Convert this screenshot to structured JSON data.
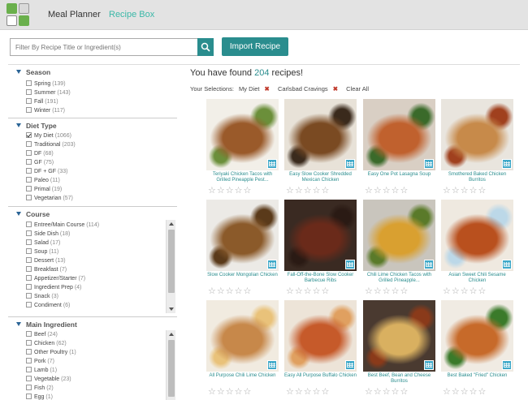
{
  "header": {
    "nav_planner": "Meal Planner",
    "nav_recipes": "Recipe Box"
  },
  "toolbar": {
    "search_placeholder": "Filter By Recipe Title or Ingredient(s)",
    "import_label": "Import Recipe"
  },
  "sidebar": {
    "season": {
      "title": "Season",
      "options": [
        {
          "label": "Spring",
          "count": "(139)",
          "checked": false
        },
        {
          "label": "Summer",
          "count": "(143)",
          "checked": false
        },
        {
          "label": "Fall",
          "count": "(191)",
          "checked": false
        },
        {
          "label": "Winter",
          "count": "(117)",
          "checked": false
        }
      ]
    },
    "diet": {
      "title": "Diet Type",
      "options": [
        {
          "label": "My Diet",
          "count": "(1066)",
          "checked": true
        },
        {
          "label": "Traditional",
          "count": "(203)",
          "checked": false
        },
        {
          "label": "DF",
          "count": "(68)",
          "checked": false
        },
        {
          "label": "GF",
          "count": "(75)",
          "checked": false
        },
        {
          "label": "DF + GF",
          "count": "(33)",
          "checked": false
        },
        {
          "label": "Paleo",
          "count": "(11)",
          "checked": false
        },
        {
          "label": "Primal",
          "count": "(19)",
          "checked": false
        },
        {
          "label": "Vegetarian",
          "count": "(57)",
          "checked": false
        }
      ]
    },
    "course": {
      "title": "Course",
      "options": [
        {
          "label": "Entree/Main Course",
          "count": "(114)",
          "checked": false
        },
        {
          "label": "Side Dish",
          "count": "(18)",
          "checked": false
        },
        {
          "label": "Salad",
          "count": "(17)",
          "checked": false
        },
        {
          "label": "Soup",
          "count": "(11)",
          "checked": false
        },
        {
          "label": "Dessert",
          "count": "(13)",
          "checked": false
        },
        {
          "label": "Breakfast",
          "count": "(7)",
          "checked": false
        },
        {
          "label": "Appetizer/Starter",
          "count": "(7)",
          "checked": false
        },
        {
          "label": "Ingredient Prep",
          "count": "(4)",
          "checked": false
        },
        {
          "label": "Snack",
          "count": "(3)",
          "checked": false
        },
        {
          "label": "Condiment",
          "count": "(6)",
          "checked": false
        }
      ]
    },
    "ingredient": {
      "title": "Main Ingredient",
      "options": [
        {
          "label": "Beef",
          "count": "(24)",
          "checked": false
        },
        {
          "label": "Chicken",
          "count": "(62)",
          "checked": false
        },
        {
          "label": "Other Poultry",
          "count": "(1)",
          "checked": false
        },
        {
          "label": "Pork",
          "count": "(7)",
          "checked": false
        },
        {
          "label": "Lamb",
          "count": "(1)",
          "checked": false
        },
        {
          "label": "Vegetable",
          "count": "(23)",
          "checked": false
        },
        {
          "label": "Fish",
          "count": "(2)",
          "checked": false
        },
        {
          "label": "Egg",
          "count": "(1)",
          "checked": false
        }
      ]
    }
  },
  "results": {
    "found_prefix": "You have found ",
    "found_count": "204",
    "found_suffix": " recipes!",
    "selections_label": "Your Selections:",
    "selection_1": "My Diet",
    "selection_2": "Carlsbad Cravings",
    "clear_all": "Clear All",
    "x_glyph": "✖",
    "stars": "☆☆☆☆☆"
  },
  "recipes": [
    {
      "title": "Teriyaki Chicken Tacos with Grilled Pineapple Pest...",
      "colors": [
        "#f2efe8",
        "#9a5a2a",
        "#6b8f3a"
      ]
    },
    {
      "title": "Easy Slow Cooker Shredded Mexican Chicken",
      "colors": [
        "#e8e2d8",
        "#7a4a22",
        "#3a2a1c"
      ]
    },
    {
      "title": "Easy One Pot Lasagna Soup",
      "colors": [
        "#d9cfc4",
        "#c0612e",
        "#3a6a2a"
      ]
    },
    {
      "title": "Smothered Baked Chicken Burritos",
      "colors": [
        "#e9e5de",
        "#c78a4a",
        "#a0401e"
      ]
    },
    {
      "title": "Slow Cooker Mongolian Chicken",
      "colors": [
        "#eceae6",
        "#8b5a2a",
        "#5a3a1a"
      ]
    },
    {
      "title": "Fall-Off-the-Bone Slow Cooker Barbecue Ribs",
      "colors": [
        "#3a2a22",
        "#6a2a1a",
        "#2a1a14"
      ]
    },
    {
      "title": "Chili Lime Chicken Tacos with Grilled Pineapple...",
      "colors": [
        "#c9c5bd",
        "#d9a030",
        "#5a7a2a"
      ]
    },
    {
      "title": "Asian Sweet Chili Sesame Chicken",
      "colors": [
        "#efe9e0",
        "#b9501e",
        "#bcd8e8"
      ]
    },
    {
      "title": "All Purpose Chili Lime Chicken",
      "colors": [
        "#f1ebe0",
        "#c7884a",
        "#e9c27a"
      ]
    },
    {
      "title": "Easy All Purpose Buffalo Chicken",
      "colors": [
        "#ede4d8",
        "#c65a2a",
        "#e0a060"
      ]
    },
    {
      "title": "Best Beef, Bean and Cheese Burritos",
      "colors": [
        "#4a3a30",
        "#d9b060",
        "#8a3a1a"
      ]
    },
    {
      "title": "Best Baked \"Fried\" Chicken",
      "colors": [
        "#f0ebe3",
        "#c76a2a",
        "#3a7a2a"
      ]
    }
  ]
}
